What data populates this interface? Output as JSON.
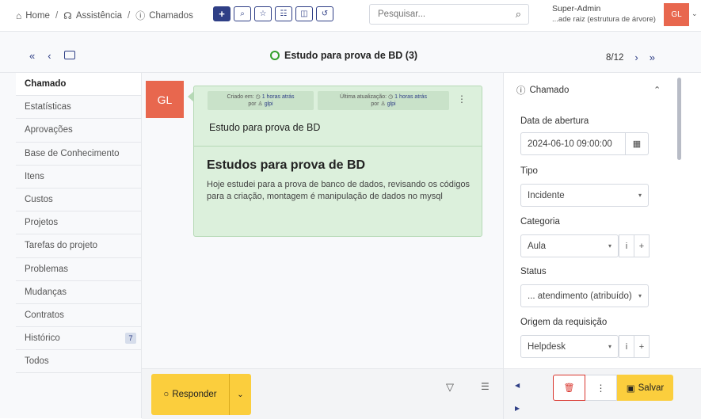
{
  "header": {
    "breadcrumbs": [
      {
        "icon": "home-icon",
        "label": "Home"
      },
      {
        "icon": "headset-icon",
        "label": "Assistência"
      },
      {
        "icon": "alert-circle-icon",
        "label": "Chamados"
      }
    ],
    "separator": "/",
    "toolbar_icons": [
      "plus-icon",
      "search-icon",
      "star-icon",
      "template-icon",
      "columns-icon",
      "reset-icon"
    ],
    "search": {
      "placeholder": "Pesquisar..."
    },
    "user": {
      "name": "Super-Admin",
      "entity": "...ade raiz (estrutura de árvore)",
      "avatar_initials": "GL"
    }
  },
  "navbar": {
    "ticket_title": "Estudo para prova de BD (3)",
    "position": "8/12"
  },
  "tabs": [
    {
      "label": "Chamado",
      "active": true
    },
    {
      "label": "Estatísticas"
    },
    {
      "label": "Aprovações"
    },
    {
      "label": "Base de Conhecimento"
    },
    {
      "label": "Itens"
    },
    {
      "label": "Custos"
    },
    {
      "label": "Projetos"
    },
    {
      "label": "Tarefas do projeto"
    },
    {
      "label": "Problemas"
    },
    {
      "label": "Mudanças"
    },
    {
      "label": "Contratos"
    },
    {
      "label": "Histórico",
      "badge": "7"
    },
    {
      "label": "Todos"
    }
  ],
  "timeline": {
    "avatar_initials": "GL",
    "created": {
      "label": "Criado em:",
      "time": "1 horas atrás",
      "by": "por",
      "user": "glpi"
    },
    "updated": {
      "label": "Última atualização:",
      "time": "1 horas atrás",
      "by": "por",
      "user": "glpi"
    },
    "item_title": "Estudo para prova de BD",
    "content_title": "Estudos para prova de BD",
    "content_body": "Hoje estudei para a prova de banco de dados, revisando os códigos para a criação, montagem é manipulação de dados no mysql"
  },
  "actions": {
    "respond_label": "Responder"
  },
  "right_panel": {
    "section_title": "Chamado",
    "fields": {
      "opening_date": {
        "label": "Data de abertura",
        "value": "2024-06-10 09:00:00"
      },
      "type": {
        "label": "Tipo",
        "value": "Incidente"
      },
      "category": {
        "label": "Categoria",
        "value": "Aula"
      },
      "status": {
        "label": "Status",
        "value": "... atendimento (atribuído)"
      },
      "request_source": {
        "label": "Origem da requisição",
        "value": "Helpdesk"
      }
    },
    "save_label": "Salvar"
  },
  "colors": {
    "primary": "#2f3f86",
    "accent": "#fbce3d",
    "avatar": "#e8674e",
    "followup_bg": "#dcf0dc",
    "danger": "#d9362e"
  }
}
